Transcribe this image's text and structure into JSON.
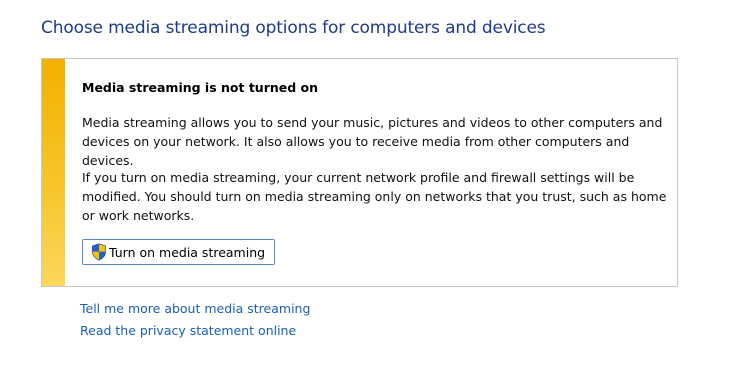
{
  "title": "Choose media streaming options for computers and devices",
  "notice": {
    "heading": "Media streaming is not turned on",
    "paragraph1": "Media streaming allows you to send your music, pictures and videos to other computers and devices on your network.  It also allows you to receive media from other computers and devices.",
    "paragraph2": "If you turn on media streaming, your current network profile and firewall settings will be modified. You should turn on media streaming only on networks that you trust, such as home or work networks.",
    "button_label": "Turn on media streaming",
    "button_icon": "uac-shield-icon",
    "stripe_color": "#f2b100"
  },
  "links": {
    "learn_more": "Tell me more about media streaming",
    "privacy": "Read the privacy statement online"
  },
  "colors": {
    "title": "#1e3a8a",
    "link": "#1a5fb4",
    "button_border": "#5b86c6"
  }
}
